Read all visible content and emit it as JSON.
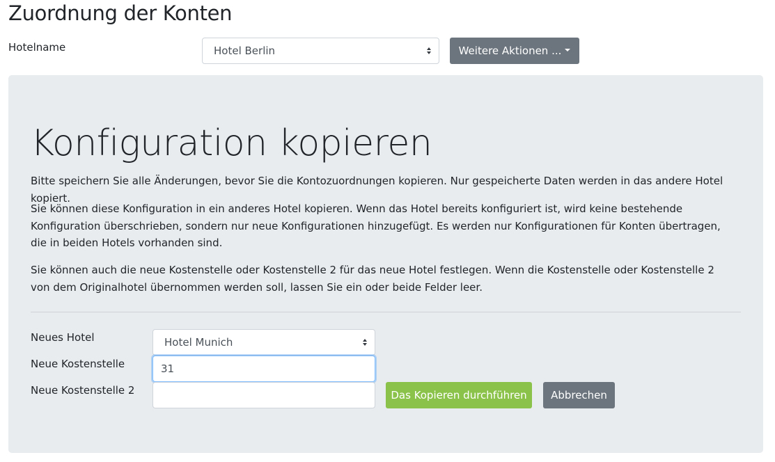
{
  "header": {
    "title": "Zuordnung der Konten",
    "hotel_label": "Hotelname",
    "hotel_select_value": "Hotel Berlin",
    "more_actions_label": "Weitere Aktionen ..."
  },
  "panel": {
    "title": "Konfiguration kopieren",
    "paragraphs": [
      "Bitte speichern Sie alle Änderungen, bevor Sie die Kontozuordnungen kopieren. Nur gespeicherte Daten werden in das andere Hotel kopiert.",
      "Sie können diese Konfiguration in ein anderes Hotel kopieren. Wenn das Hotel bereits konfiguriert ist, wird keine bestehende Konfiguration überschrieben, sondern nur neue Konfigurationen hinzugefügt. Es werden nur Konfigurationen für Konten übertragen, die in beiden Hotels vorhanden sind.",
      "Sie können auch die neue Kostenstelle oder Kostenstelle 2 für das neue Hotel festlegen. Wenn die Kostenstelle oder Kostenstelle 2 von dem Originalhotel übernommen werden soll, lassen Sie ein oder beide Felder leer."
    ],
    "form": {
      "new_hotel_label": "Neues Hotel",
      "new_hotel_value": "Hotel Munich",
      "cost_center_label": "Neue Kostenstelle",
      "cost_center_value": "31",
      "cost_center2_label": "Neue Kostenstelle 2",
      "cost_center2_value": "",
      "copy_button_label": "Das Kopieren durchführen",
      "cancel_button_label": "Abbrechen"
    }
  },
  "colors": {
    "panel_bg": "#e9ecef",
    "secondary_button": "#6c757d",
    "success_button": "#8bc34a",
    "focus_border": "#80bdff"
  }
}
